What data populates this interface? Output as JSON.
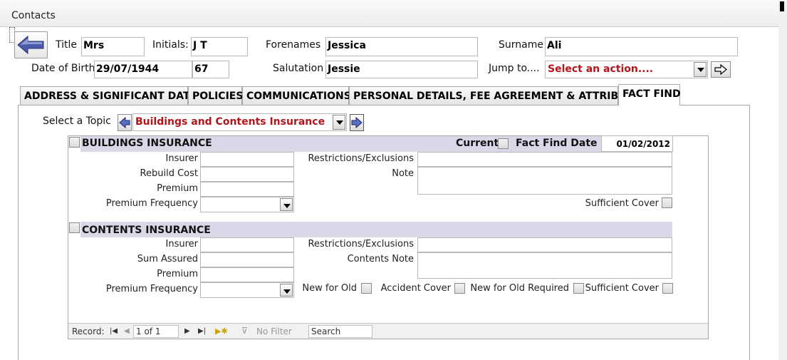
{
  "window": {
    "title": "Contacts"
  },
  "header": {
    "title_label": "Title",
    "title_value": "Mrs",
    "initials_label": "Initials:",
    "initials_value": "J T",
    "forenames_label": "Forenames",
    "forenames_value": "Jessica",
    "surname_label": "Surname",
    "surname_value": "Ali",
    "dob_label": "Date of Birth",
    "dob_value": "29/07/1944",
    "age_value": "67",
    "salutation_label": "Salutation",
    "salutation_value": "Jessie",
    "jump_label": "Jump to....",
    "jump_value": "Select an action...."
  },
  "tabs": [
    {
      "label": "ADDRESS & SIGNIFICANT DATES"
    },
    {
      "label": "POLICIES"
    },
    {
      "label": "COMMUNICATIONS"
    },
    {
      "label": "PERSONAL DETAILS, FEE AGREEMENT & ATTRIBUTES"
    },
    {
      "label": "FACT FIND",
      "active": true
    }
  ],
  "topic": {
    "label": "Select a Topic",
    "value": "Buildings and Contents Insurance"
  },
  "buildings": {
    "title": "BUILDINGS INSURANCE",
    "current_label": "Current",
    "fact_find_date_label": "Fact Find Date",
    "fact_find_date_value": "01/02/2012",
    "insurer_label": "Insurer",
    "rebuild_cost_label": "Rebuild Cost",
    "premium_label": "Premium",
    "premium_frequency_label": "Premium Frequency",
    "restrictions_label": "Restrictions/Exclusions",
    "note_label": "Note",
    "sufficient_cover_label": "Sufficient Cover"
  },
  "contents": {
    "title": "CONTENTS INSURANCE",
    "insurer_label": "Insurer",
    "sum_assured_label": "Sum Assured",
    "premium_label": "Premium",
    "premium_frequency_label": "Premium Frequency",
    "restrictions_label": "Restrictions/Exclusions",
    "contents_note_label": "Contents Note",
    "new_for_old_label": "New for Old",
    "accident_cover_label": "Accident Cover",
    "new_for_old_required_label": "New for Old Required",
    "sufficient_cover_label": "Sufficient Cover"
  },
  "record_nav": {
    "record_label": "Record:",
    "position": "1 of 1",
    "filter_label": "No Filter",
    "search_text": "Search"
  },
  "colors": {
    "accent_red": "#b3151b",
    "section_band": "#dad8e8",
    "arrow_blue": "#4a5aa8"
  },
  "icons": [
    "back-arrow-icon",
    "go-arrow-icon",
    "prev-topic-icon",
    "next-topic-icon",
    "first-record-icon",
    "prev-record-icon",
    "next-record-icon",
    "last-record-icon",
    "new-record-icon",
    "filter-icon"
  ]
}
